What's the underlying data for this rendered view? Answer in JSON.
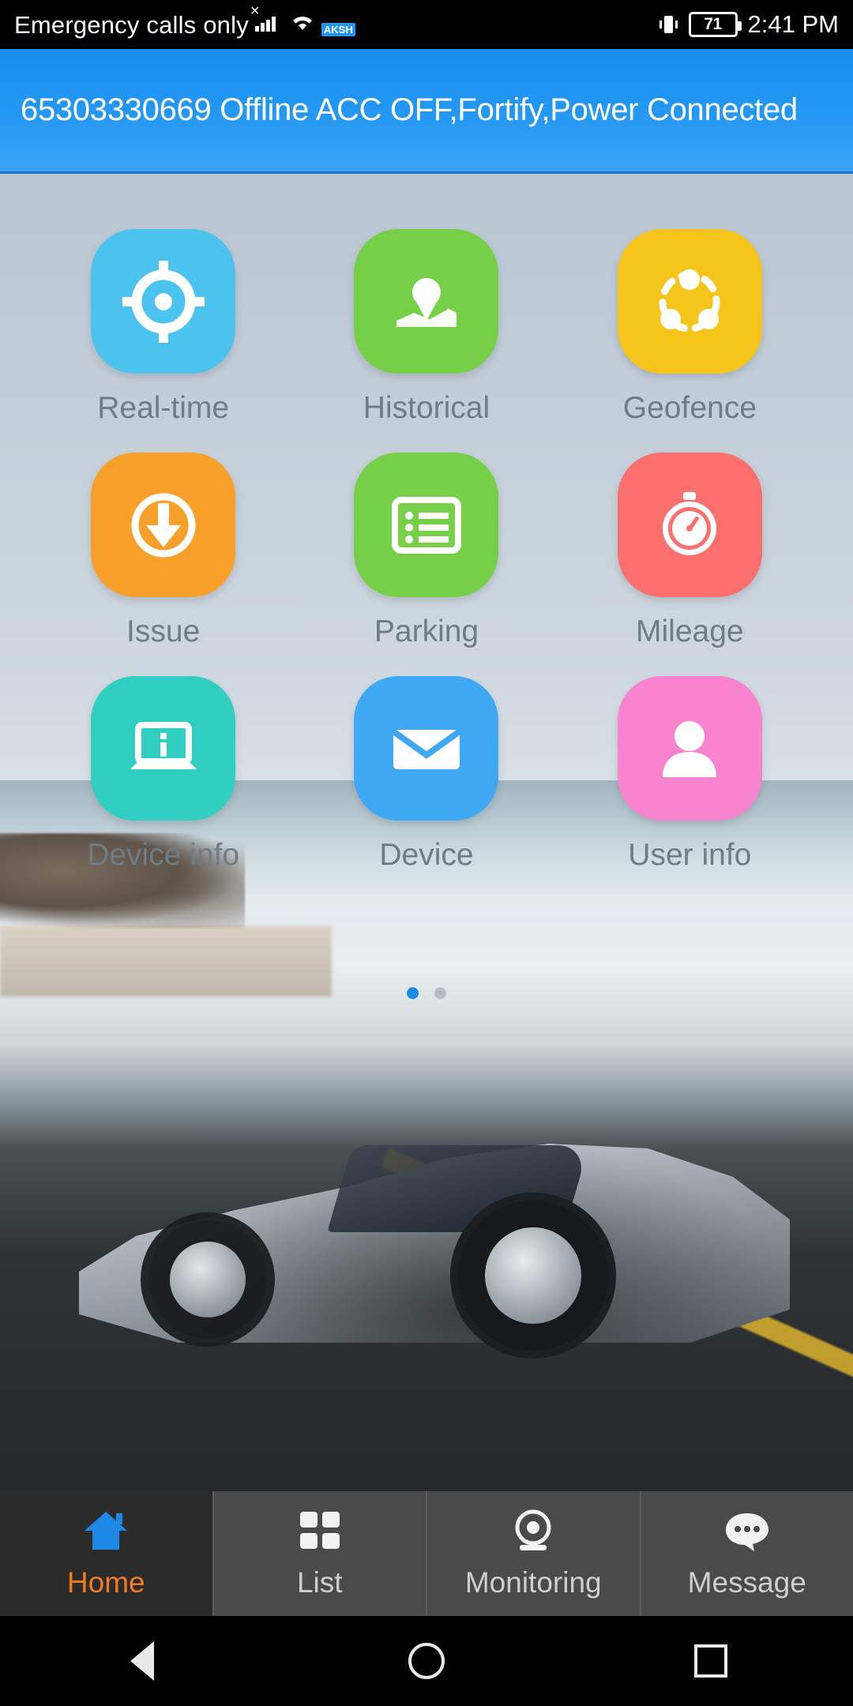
{
  "status_bar": {
    "carrier": "Emergency calls only",
    "signal_icon": "signal-bars-icon",
    "no_sim_icon": "signal-x-icon",
    "wifi_icon": "wifi-icon",
    "app_badge": "AKSH",
    "vibrate_icon": "vibrate-icon",
    "battery_level": "71",
    "time": "2:41 PM"
  },
  "banner": {
    "text": "65303330669 Offline ACC OFF,Fortify,Power Connected",
    "background_color": "#2196f3",
    "text_color": "#ffffff"
  },
  "grid": {
    "items": [
      {
        "label": "Real-time",
        "icon": "target-crosshair-icon",
        "color": "#4cc3ef"
      },
      {
        "label": "Historical",
        "icon": "map-pin-icon",
        "color": "#76d047"
      },
      {
        "label": "Geofence",
        "icon": "geofence-dots-icon",
        "color": "#f6c51c"
      },
      {
        "label": "Issue",
        "icon": "download-arrow-icon",
        "color": "#f9a02a"
      },
      {
        "label": "Parking",
        "icon": "list-card-icon",
        "color": "#76d047"
      },
      {
        "label": "Mileage",
        "icon": "stopwatch-icon",
        "color": "#fb6f6f"
      },
      {
        "label": "Device info",
        "icon": "laptop-info-icon",
        "color": "#31cfc2"
      },
      {
        "label": "Device",
        "icon": "envelope-icon",
        "color": "#3fa9f5"
      },
      {
        "label": "User info",
        "icon": "person-icon",
        "color": "#f884d0"
      }
    ],
    "label_color": "#6f7c86"
  },
  "pagination": {
    "total": 2,
    "active_index": 0,
    "active_color": "#1e88e5",
    "inactive_color": "#b7bfc6"
  },
  "tabbar": {
    "active_color": "#f07c1f",
    "inactive_color": "#cfcfcf",
    "tabs": [
      {
        "label": "Home",
        "icon": "home-icon",
        "active": true
      },
      {
        "label": "List",
        "icon": "grid-icon",
        "active": false
      },
      {
        "label": "Monitoring",
        "icon": "webcam-icon",
        "active": false
      },
      {
        "label": "Message",
        "icon": "chat-bubble-icon",
        "active": false
      }
    ]
  },
  "navbar": {
    "back": "back-triangle-icon",
    "home": "home-circle-icon",
    "recents": "recents-square-icon"
  }
}
